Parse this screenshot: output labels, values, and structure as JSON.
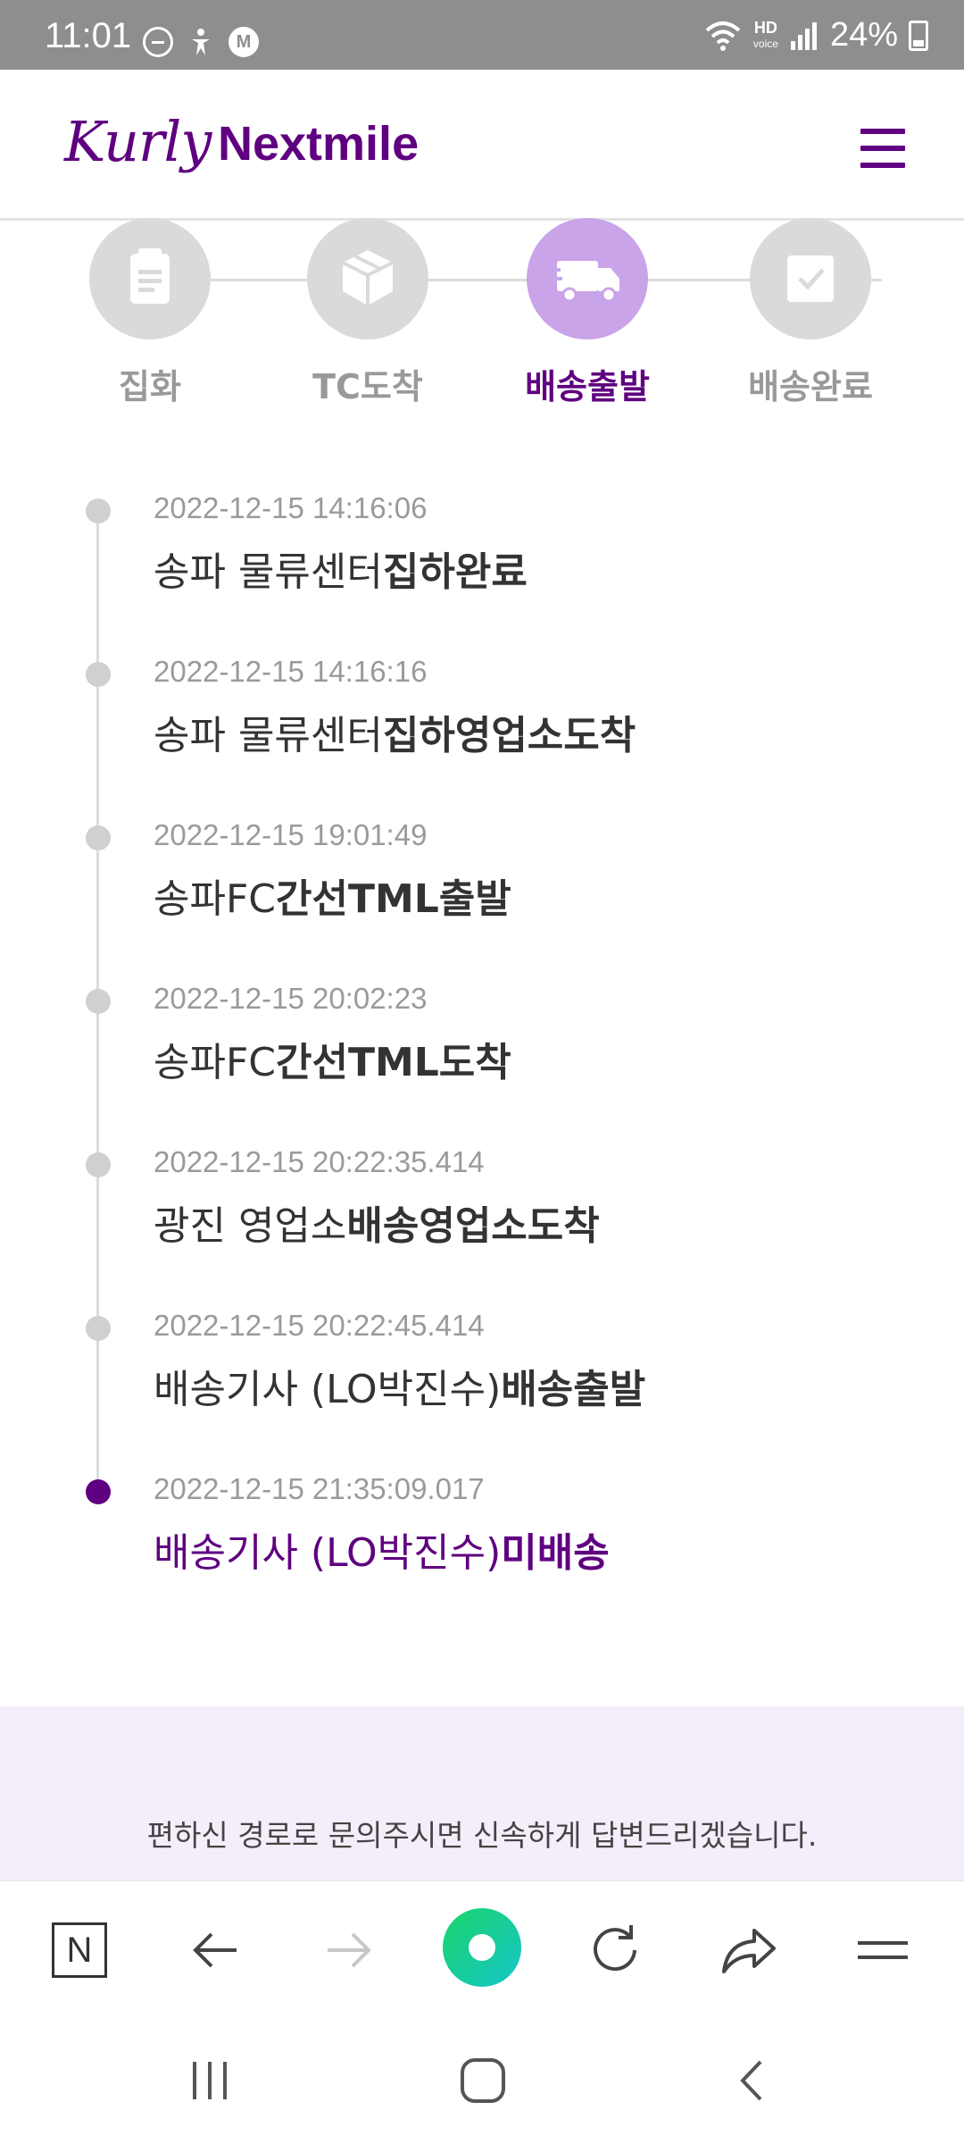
{
  "status_bar": {
    "time": "11:01",
    "hd_top": "HD",
    "hd_bottom": "voice",
    "battery": "24%"
  },
  "header": {
    "logo_script": "Kurly",
    "logo_word": "Nextmile",
    "menu_icon": "hamburger-menu-icon"
  },
  "steps": [
    {
      "label": "집화",
      "icon": "clipboard-icon",
      "active": false
    },
    {
      "label": "TC도착",
      "icon": "box-icon",
      "active": false
    },
    {
      "label": "배송출발",
      "icon": "truck-icon",
      "active": true
    },
    {
      "label": "배송완료",
      "icon": "check-icon",
      "active": false
    }
  ],
  "timeline": [
    {
      "time": "2022-12-15 14:16:06",
      "place": "송파 물류센터",
      "status": "집하완료"
    },
    {
      "time": "2022-12-15 14:16:16",
      "place": "송파 물류센터",
      "status": "집하영업소도착"
    },
    {
      "time": "2022-12-15 19:01:49",
      "place": "송파FC",
      "status": "간선TML출발"
    },
    {
      "time": "2022-12-15 20:02:23",
      "place": "송파FC",
      "status": "간선TML도착"
    },
    {
      "time": "2022-12-15 20:22:35.414",
      "place": "광진 영업소",
      "status": "배송영업소도착"
    },
    {
      "time": "2022-12-15 20:22:45.414",
      "place": "배송기사 (LO박진수)",
      "status": "배송출발"
    },
    {
      "time": "2022-12-15 21:35:09.017",
      "place": "배송기사 (LO박진수)",
      "status": "미배송"
    }
  ],
  "info": {
    "text": "편하신 경로로 문의주시면 신속하게 답변드리겠습니다."
  },
  "browser_bar": {
    "n_label": "N"
  },
  "colors": {
    "brand": "#5f0080",
    "active_step": "#c9a4e8",
    "inactive": "#dadada"
  }
}
